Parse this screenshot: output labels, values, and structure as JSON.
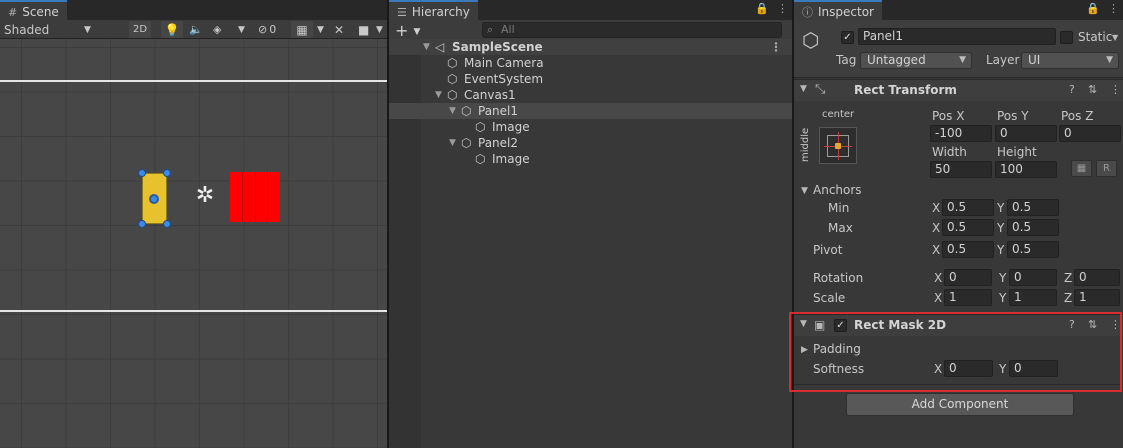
{
  "scene": {
    "tab": "Scene",
    "shading": "Shaded",
    "mode_2d": "2D",
    "hidden_count": "0"
  },
  "hierarchy": {
    "tab": "Hierarchy",
    "add_label": "+",
    "search_placeholder": "All",
    "items": [
      {
        "label": "SampleScene"
      },
      {
        "label": "Main Camera"
      },
      {
        "label": "EventSystem"
      },
      {
        "label": "Canvas1"
      },
      {
        "label": "Panel1"
      },
      {
        "label": "Image"
      },
      {
        "label": "Panel2"
      },
      {
        "label": "Image"
      }
    ]
  },
  "inspector": {
    "tab": "Inspector",
    "object_name": "Panel1",
    "static_label": "Static",
    "tag_label": "Tag",
    "tag_value": "Untagged",
    "layer_label": "Layer",
    "layer_value": "UI",
    "rect_transform": {
      "title": "Rect Transform",
      "anchor_h": "center",
      "anchor_v": "middle",
      "pos_x_label": "Pos X",
      "pos_x": "-100",
      "pos_y_label": "Pos Y",
      "pos_y": "0",
      "pos_z_label": "Pos Z",
      "pos_z": "0",
      "width_label": "Width",
      "width": "50",
      "height_label": "Height",
      "height": "100",
      "r_button": "R",
      "anchors_label": "Anchors",
      "min_label": "Min",
      "min_x": "0.5",
      "min_y": "0.5",
      "max_label": "Max",
      "max_x": "0.5",
      "max_y": "0.5",
      "pivot_label": "Pivot",
      "pivot_x": "0.5",
      "pivot_y": "0.5",
      "rotation_label": "Rotation",
      "rot_x": "0",
      "rot_y": "0",
      "rot_z": "0",
      "scale_label": "Scale",
      "scale_x": "1",
      "scale_y": "1",
      "scale_z": "1",
      "x": "X",
      "y": "Y",
      "z": "Z"
    },
    "rect_mask": {
      "title": "Rect Mask 2D",
      "padding_label": "Padding",
      "softness_label": "Softness",
      "softness_x": "0",
      "softness_y": "0"
    },
    "add_component": "Add Component"
  },
  "colors": {
    "accent": "#3a79bb",
    "highlight": "#d52d2d",
    "panel_yellow": "#e8c22c",
    "panel_red": "#ff0000",
    "handle_blue": "#3b8ae6"
  }
}
